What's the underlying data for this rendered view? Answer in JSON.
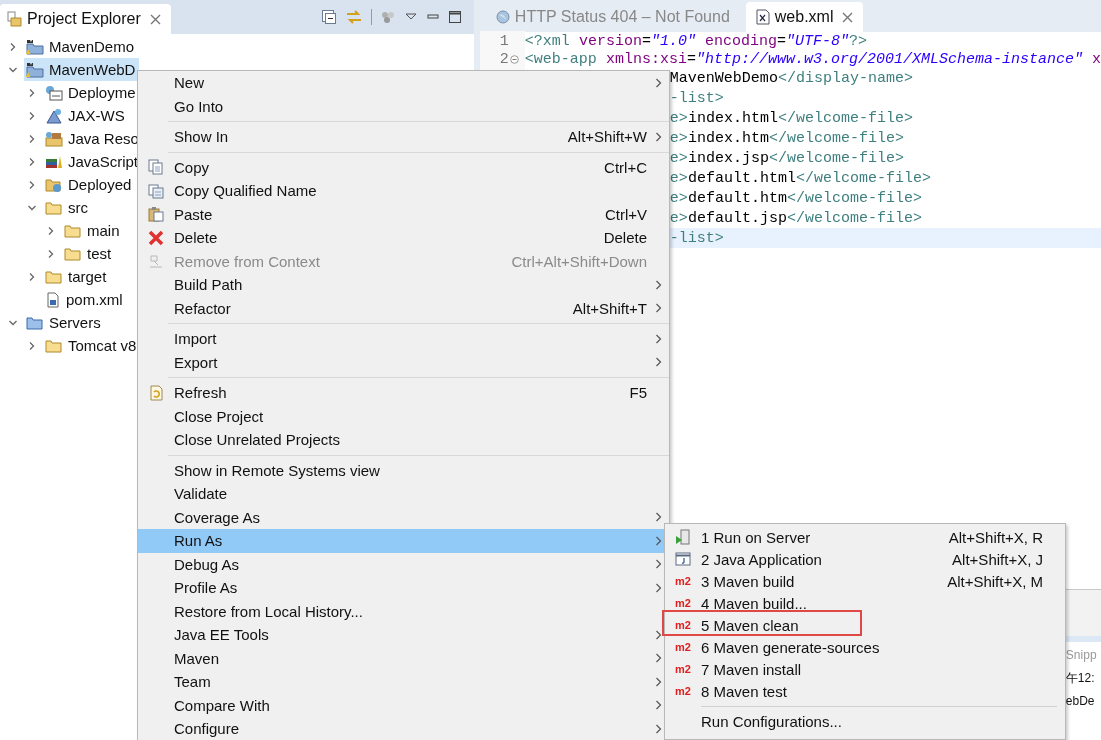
{
  "explorer": {
    "title": "Project Explorer"
  },
  "tree": [
    {
      "label": "MavenDemo",
      "kind": "project",
      "expanded": false,
      "selected": false
    },
    {
      "label": "MavenWebD",
      "kind": "project",
      "expanded": true,
      "selected": true,
      "children": [
        {
          "label": "Deployme",
          "kind": "descriptor",
          "expanded": false,
          "selected": false
        },
        {
          "label": "JAX-WS",
          "kind": "webservice",
          "expanded": false,
          "selected": false
        },
        {
          "label": "Java Reso",
          "kind": "resources",
          "expanded": false,
          "selected": false
        },
        {
          "label": "JavaScript",
          "kind": "javascript",
          "expanded": false,
          "selected": false
        },
        {
          "label": "Deployed",
          "kind": "deployed",
          "expanded": false,
          "selected": false
        },
        {
          "label": "src",
          "kind": "folder",
          "expanded": true,
          "selected": false,
          "children": [
            {
              "label": "main",
              "kind": "folder",
              "expanded": false,
              "selected": false
            },
            {
              "label": "test",
              "kind": "folder",
              "expanded": false,
              "selected": false
            }
          ]
        },
        {
          "label": "target",
          "kind": "folder",
          "expanded": false,
          "selected": false
        },
        {
          "label": "pom.xml",
          "kind": "pom",
          "selected": false
        }
      ]
    },
    {
      "label": "Servers",
      "kind": "serverfolder",
      "expanded": true,
      "selected": false,
      "children": [
        {
          "label": "Tomcat v8",
          "kind": "folder",
          "expanded": false,
          "selected": false
        }
      ]
    }
  ],
  "editor": {
    "tabs": [
      {
        "title": "HTTP Status 404 – Not Found",
        "kind": "browser",
        "selected": false
      },
      {
        "title": "web.xml",
        "kind": "xml",
        "selected": true
      }
    ],
    "lines": [
      {
        "number": "1",
        "fold": false,
        "current": false,
        "tokens": [
          {
            "kind": "tag",
            "t": "<?xml"
          },
          {
            "kind": "attr",
            "t": " version"
          },
          {
            "kind": "plain",
            "t": "="
          },
          {
            "kind": "string",
            "t": "\"1.0\""
          },
          {
            "kind": "attr",
            "t": " encoding"
          },
          {
            "kind": "plain",
            "t": "="
          },
          {
            "kind": "string",
            "t": "\"UTF-8\""
          },
          {
            "kind": "tag",
            "t": "?>"
          }
        ]
      },
      {
        "number": "2",
        "fold": true,
        "current": false,
        "tokens": [
          {
            "kind": "tag",
            "t": "<web-app"
          },
          {
            "kind": "attr",
            "t": " xmlns:xsi"
          },
          {
            "kind": "plain",
            "t": "="
          },
          {
            "kind": "string",
            "t": "\"http://www.w3.org/2001/XMLSchema-instance\""
          },
          {
            "kind": "attr",
            "t": " x"
          }
        ]
      },
      {
        "covered": true,
        "current": false,
        "tokens": [
          {
            "kind": "text",
            "t": "MavenWebDemo"
          },
          {
            "kind": "tag",
            "t": "</display-name>"
          }
        ]
      },
      {
        "covered": true,
        "current": false,
        "tokens": [
          {
            "kind": "tag",
            "t": "-list>"
          }
        ]
      },
      {
        "covered": true,
        "current": false,
        "tokens": [
          {
            "kind": "tag",
            "t": "e>"
          },
          {
            "kind": "text",
            "t": "index.html"
          },
          {
            "kind": "tag",
            "t": "</welcome-file>"
          }
        ]
      },
      {
        "covered": true,
        "current": false,
        "tokens": [
          {
            "kind": "tag",
            "t": "e>"
          },
          {
            "kind": "text",
            "t": "index.htm"
          },
          {
            "kind": "tag",
            "t": "</welcome-file>"
          }
        ]
      },
      {
        "covered": true,
        "current": false,
        "tokens": [
          {
            "kind": "tag",
            "t": "e>"
          },
          {
            "kind": "text",
            "t": "index.jsp"
          },
          {
            "kind": "tag",
            "t": "</welcome-file>"
          }
        ]
      },
      {
        "covered": true,
        "current": false,
        "tokens": [
          {
            "kind": "tag",
            "t": "e>"
          },
          {
            "kind": "text",
            "t": "default.html"
          },
          {
            "kind": "tag",
            "t": "</welcome-file>"
          }
        ]
      },
      {
        "covered": true,
        "current": false,
        "tokens": [
          {
            "kind": "tag",
            "t": "e>"
          },
          {
            "kind": "text",
            "t": "default.htm"
          },
          {
            "kind": "tag",
            "t": "</welcome-file>"
          }
        ]
      },
      {
        "covered": true,
        "current": false,
        "tokens": [
          {
            "kind": "tag",
            "t": "e>"
          },
          {
            "kind": "text",
            "t": "default.jsp"
          },
          {
            "kind": "tag",
            "t": "</welcome-file>"
          }
        ]
      },
      {
        "covered": true,
        "current": true,
        "tokens": [
          {
            "kind": "tag",
            "t": "-list>"
          }
        ]
      }
    ]
  },
  "bottom_panel": {
    "texts": [
      {
        "text": "Snipp",
        "kind": "tab"
      },
      {
        "text": "午12:",
        "kind": "row"
      },
      {
        "text": "ebDe",
        "kind": "row"
      }
    ]
  },
  "context_menu": {
    "items": [
      {
        "kind": "item",
        "label": "New",
        "submenu": true,
        "disabled": false,
        "selected": false
      },
      {
        "kind": "item",
        "label": "Go Into",
        "submenu": false,
        "disabled": false,
        "selected": false
      },
      {
        "kind": "separator"
      },
      {
        "kind": "item",
        "label": "Show In",
        "shortcut": "Alt+Shift+W",
        "submenu": true,
        "disabled": false,
        "selected": false
      },
      {
        "kind": "separator"
      },
      {
        "kind": "copy",
        "label": "Copy",
        "shortcut": "Ctrl+C",
        "submenu": false,
        "disabled": false,
        "selected": false
      },
      {
        "kind": "copyname",
        "label": "Copy Qualified Name",
        "submenu": false,
        "disabled": false,
        "selected": false
      },
      {
        "kind": "paste",
        "label": "Paste",
        "shortcut": "Ctrl+V",
        "submenu": false,
        "disabled": false,
        "selected": false
      },
      {
        "kind": "delete",
        "label": "Delete",
        "shortcut": "Delete",
        "submenu": false,
        "disabled": false,
        "selected": false
      },
      {
        "kind": "remove",
        "label": "Remove from Context",
        "shortcut": "Ctrl+Alt+Shift+Down",
        "submenu": false,
        "disabled": true,
        "selected": false
      },
      {
        "kind": "item",
        "label": "Build Path",
        "submenu": true,
        "disabled": false,
        "selected": false
      },
      {
        "kind": "item",
        "label": "Refactor",
        "shortcut": "Alt+Shift+T",
        "submenu": true,
        "disabled": false,
        "selected": false
      },
      {
        "kind": "separator"
      },
      {
        "kind": "item",
        "label": "Import",
        "submenu": true,
        "disabled": false,
        "selected": false
      },
      {
        "kind": "item",
        "label": "Export",
        "submenu": true,
        "disabled": false,
        "selected": false
      },
      {
        "kind": "separator"
      },
      {
        "kind": "refresh",
        "label": "Refresh",
        "shortcut": "F5",
        "submenu": false,
        "disabled": false,
        "selected": false
      },
      {
        "kind": "item",
        "label": "Close Project",
        "submenu": false,
        "disabled": false,
        "selected": false
      },
      {
        "kind": "item",
        "label": "Close Unrelated Projects",
        "submenu": false,
        "disabled": false,
        "selected": false
      },
      {
        "kind": "separator"
      },
      {
        "kind": "item",
        "label": "Show in Remote Systems view",
        "submenu": false,
        "disabled": false,
        "selected": false
      },
      {
        "kind": "item",
        "label": "Validate",
        "submenu": false,
        "disabled": false,
        "selected": false
      },
      {
        "kind": "item",
        "label": "Coverage As",
        "submenu": true,
        "disabled": false,
        "selected": false
      },
      {
        "kind": "item",
        "label": "Run As",
        "submenu": true,
        "disabled": false,
        "selected": true
      },
      {
        "kind": "item",
        "label": "Debug As",
        "submenu": true,
        "disabled": false,
        "selected": false
      },
      {
        "kind": "item",
        "label": "Profile As",
        "submenu": true,
        "disabled": false,
        "selected": false
      },
      {
        "kind": "item",
        "label": "Restore from Local History...",
        "submenu": false,
        "disabled": false,
        "selected": false
      },
      {
        "kind": "item",
        "label": "Java EE Tools",
        "submenu": true,
        "disabled": false,
        "selected": false
      },
      {
        "kind": "item",
        "label": "Maven",
        "submenu": true,
        "disabled": false,
        "selected": false
      },
      {
        "kind": "item",
        "label": "Team",
        "submenu": true,
        "disabled": false,
        "selected": false
      },
      {
        "kind": "item",
        "label": "Compare With",
        "submenu": true,
        "disabled": false,
        "selected": false
      },
      {
        "kind": "item",
        "label": "Configure",
        "submenu": true,
        "disabled": false,
        "selected": false
      }
    ]
  },
  "submenu": {
    "items": [
      {
        "kind": "server",
        "label": "1 Run on Server",
        "shortcut": "Alt+Shift+X, R",
        "outlined": false
      },
      {
        "kind": "java",
        "label": "2 Java Application",
        "shortcut": "Alt+Shift+X, J",
        "outlined": false
      },
      {
        "kind": "maven",
        "icon_text": "m2",
        "label": "3 Maven build",
        "shortcut": "Alt+Shift+X, M",
        "outlined": false
      },
      {
        "kind": "maven",
        "icon_text": "m2",
        "label": "4 Maven build...",
        "outlined": false
      },
      {
        "kind": "maven",
        "icon_text": "m2",
        "label": "5 Maven clean",
        "outlined": true
      },
      {
        "kind": "maven",
        "icon_text": "m2",
        "label": "6 Maven generate-sources",
        "outlined": false
      },
      {
        "kind": "maven",
        "icon_text": "m2",
        "label": "7 Maven install",
        "outlined": false
      },
      {
        "kind": "maven",
        "icon_text": "m2",
        "label": "8 Maven test",
        "outlined": false
      },
      {
        "kind": "separator"
      },
      {
        "kind": "item",
        "label": "Run Configurations...",
        "outlined": false
      }
    ]
  }
}
